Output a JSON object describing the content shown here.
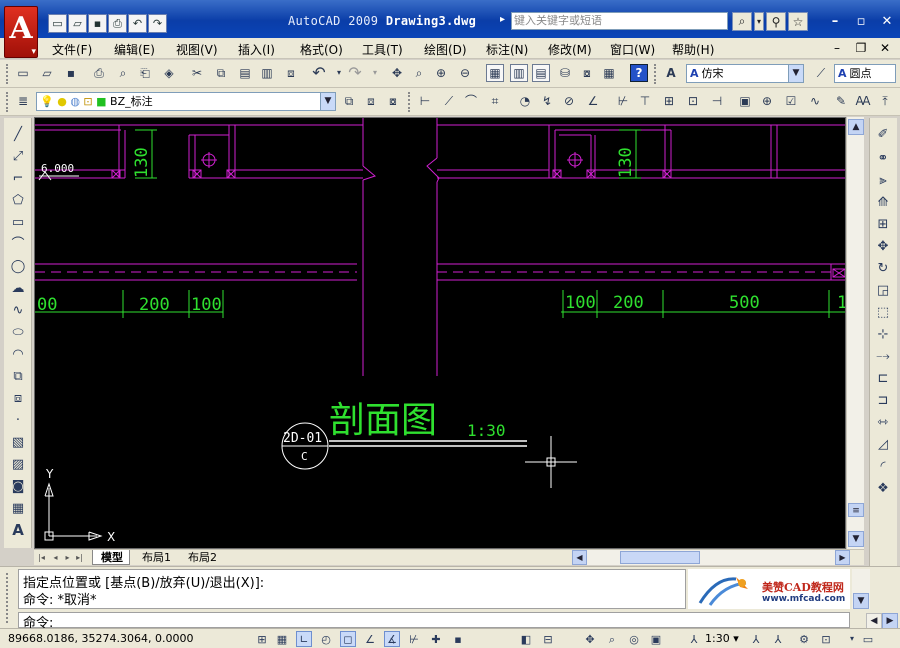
{
  "window": {
    "logo_letter": "A",
    "title_app": "AutoCAD 2009",
    "title_file": "Drawing3.dwg",
    "help_placeholder": "键入关键字或短语"
  },
  "menu": [
    {
      "label": "文件(F)",
      "name": "menu-file"
    },
    {
      "label": "编辑(E)",
      "name": "menu-edit"
    },
    {
      "label": "视图(V)",
      "name": "menu-view"
    },
    {
      "label": "插入(I)",
      "name": "menu-insert"
    },
    {
      "label": "格式(O)",
      "name": "menu-format"
    },
    {
      "label": "工具(T)",
      "name": "menu-tools"
    },
    {
      "label": "绘图(D)",
      "name": "menu-draw"
    },
    {
      "label": "标注(N)",
      "name": "menu-dimension"
    },
    {
      "label": "修改(M)",
      "name": "menu-modify"
    },
    {
      "label": "窗口(W)",
      "name": "menu-window"
    },
    {
      "label": "帮助(H)",
      "name": "menu-help"
    }
  ],
  "styles": {
    "text_style": "仿宋",
    "dim_style": "圆点"
  },
  "layer": {
    "current": "BZ_标注"
  },
  "drawing": {
    "elevation": "6.000",
    "dim_vertical_left": "130",
    "dim_vertical_right": "130",
    "dims_left": [
      "00",
      "200",
      "100"
    ],
    "dims_right": [
      "100",
      "200",
      "500",
      "1"
    ],
    "section_title": "剖面图",
    "section_scale": "1:30",
    "section_id": "2D-01",
    "section_sheet": "C",
    "ucs_x": "X",
    "ucs_y": "Y",
    "colors": {
      "magenta": "#d020d0",
      "green": "#2fe02f",
      "white": "#ffffff"
    }
  },
  "tabs": {
    "model": "模型",
    "layout1": "布局1",
    "layout2": "布局2"
  },
  "command": {
    "line1": "指定点位置或 [基点(B)/放弃(U)/退出(X)]:",
    "line2": "命令: *取消*",
    "prompt": "命令:"
  },
  "watermark": {
    "title": "美赞CAD教程网",
    "url": "www.mfcad.com"
  },
  "status": {
    "coordinates": "89668.0186, 35274.3064, 0.0000",
    "annotation_scale": "1:30"
  }
}
